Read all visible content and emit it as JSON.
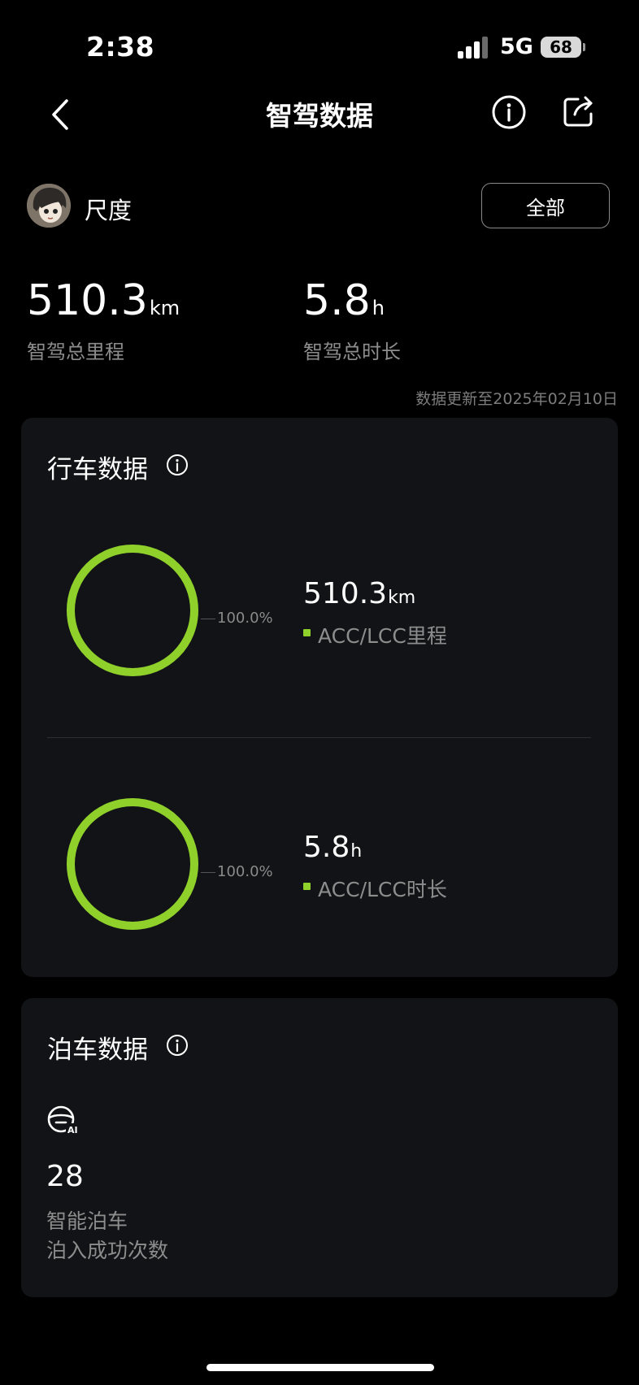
{
  "status_bar": {
    "time": "2:38",
    "network": "5G",
    "battery": "68"
  },
  "header": {
    "title": "智驾数据"
  },
  "profile": {
    "name": "尺度",
    "filter_label": "全部"
  },
  "summary": {
    "mileage": {
      "value": "510.3",
      "unit": "km",
      "label": "智驾总里程"
    },
    "duration": {
      "value": "5.8",
      "unit": "h",
      "label": "智驾总时长"
    },
    "update_text": "数据更新至2025年02月10日"
  },
  "driving": {
    "title": "行车数据",
    "items": [
      {
        "value": "510.3",
        "unit": "km",
        "label": "ACC/LCC里程",
        "percent_text": "100.0%",
        "fraction": 1.0
      },
      {
        "value": "5.8",
        "unit": "h",
        "label": "ACC/LCC时长",
        "percent_text": "100.0%",
        "fraction": 1.0
      }
    ]
  },
  "parking": {
    "title": "泊车数据",
    "icon": "steering-wheel-ai-icon",
    "icon_badge": "AI",
    "count": "28",
    "label_line1": "智能泊车",
    "label_line2": "泊入成功次数"
  },
  "colors": {
    "accent": "#8fd12a",
    "card": "#121316",
    "background": "#000000"
  }
}
